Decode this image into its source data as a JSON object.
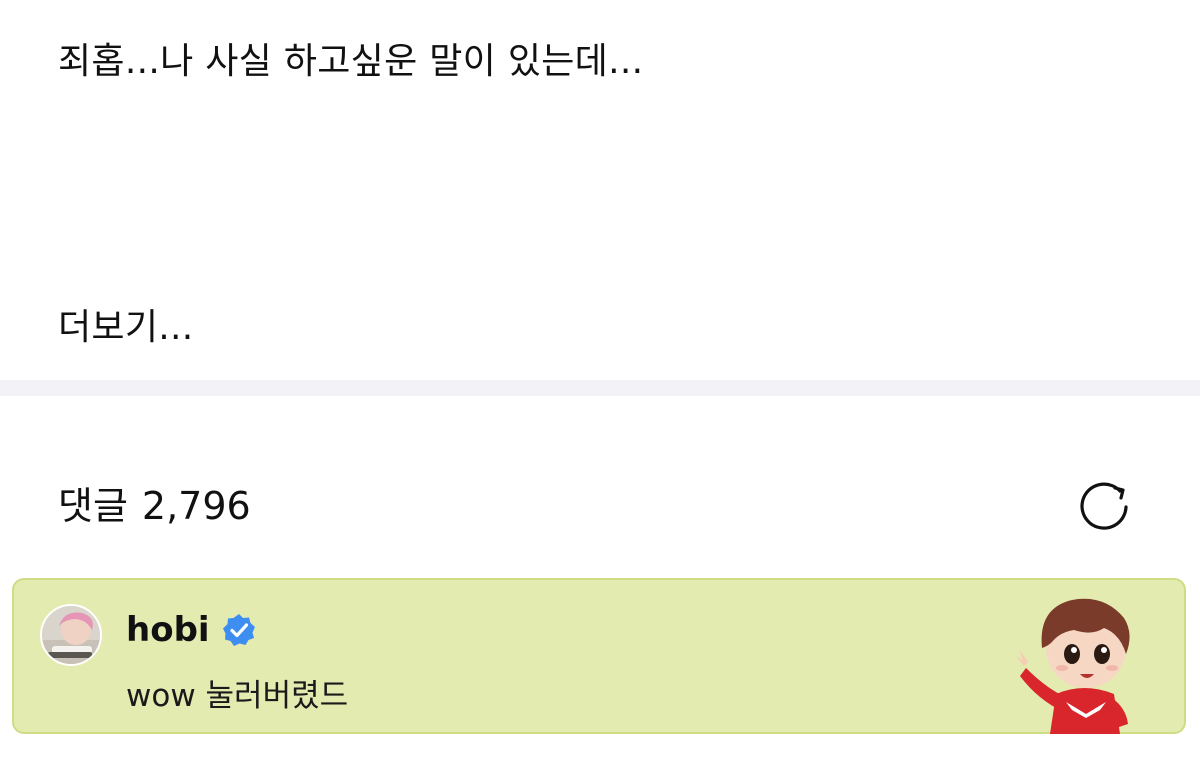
{
  "post": {
    "body_text": "죄홉...나 사실 하고싶운 말이 있는데...",
    "read_more_label": "더보기..."
  },
  "comments": {
    "label": "댓글",
    "count": "2,796",
    "refresh_icon": "refresh-icon"
  },
  "pinned_comment": {
    "username": "hobi",
    "verified_icon": "verified-badge-icon",
    "text": "wow 눌러버렸드",
    "sticker": "character-sticker",
    "background_color": "#e4ebb0",
    "border_color": "#cfdc86"
  },
  "colors": {
    "divider": "#f3f3f7",
    "verified_blue": "#3d8ef0"
  }
}
